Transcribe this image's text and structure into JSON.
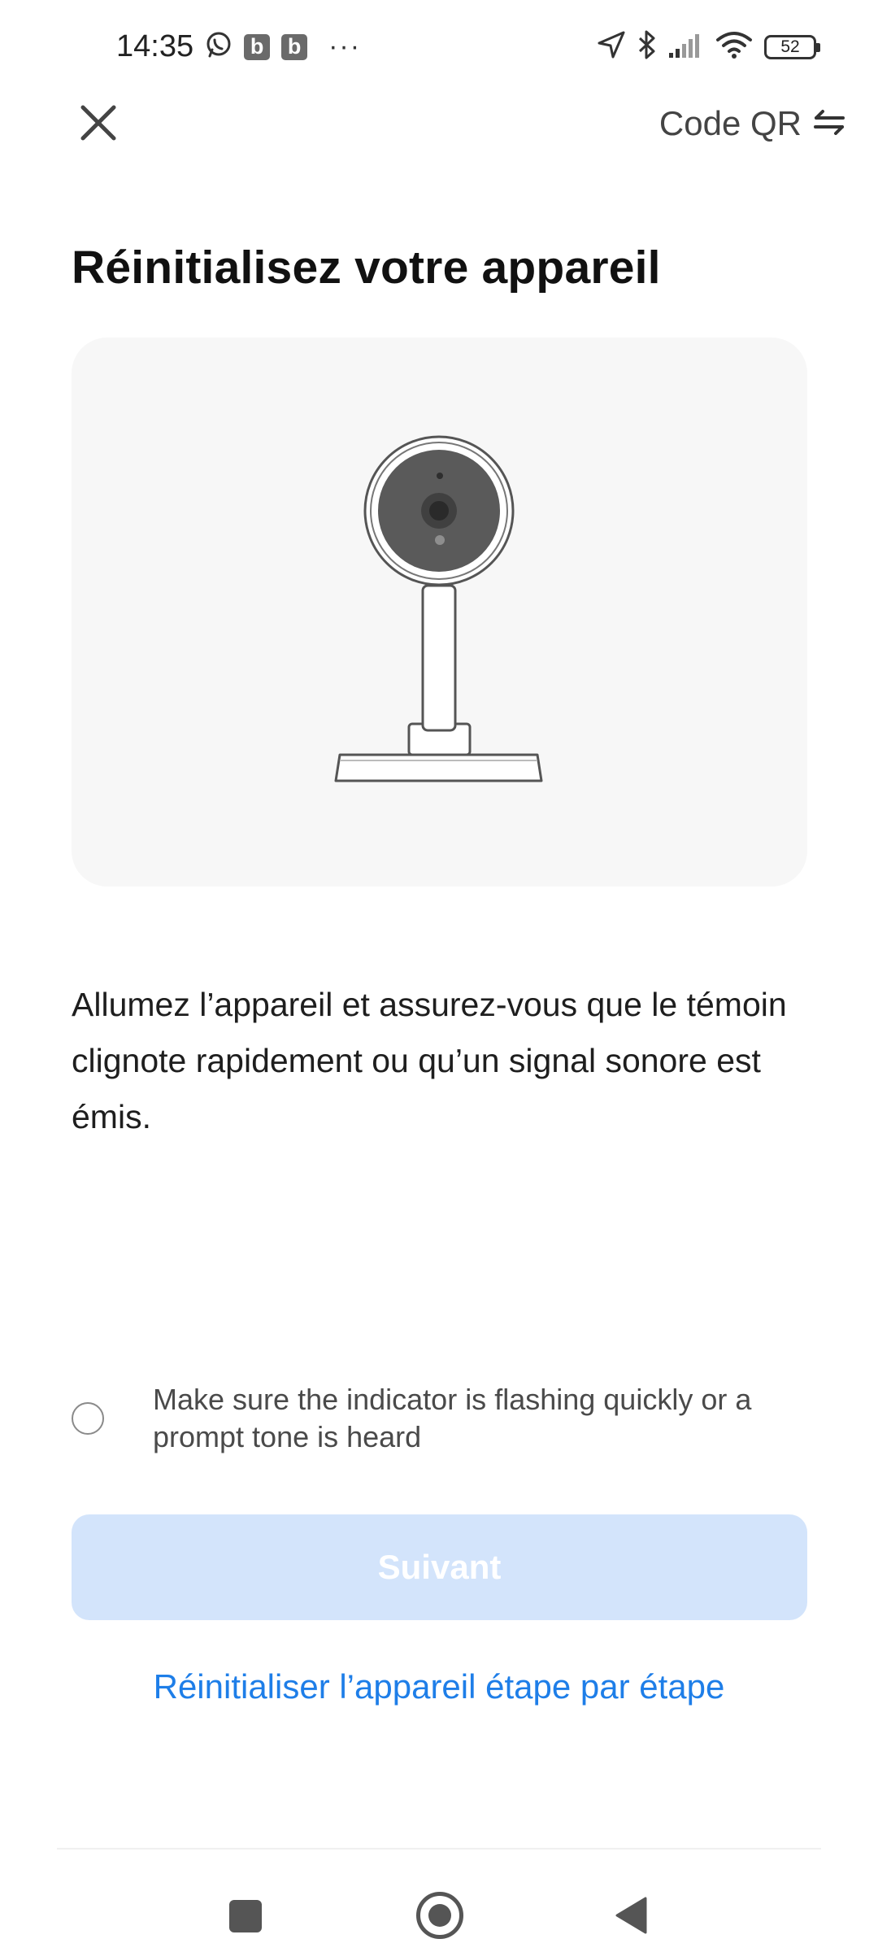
{
  "status_bar": {
    "time": "14:35",
    "badge_1": "b",
    "badge_2": "b",
    "more": "···",
    "battery": "52",
    "icons": [
      "whatsapp-icon",
      "location-icon",
      "bluetooth-icon",
      "signal-icon",
      "wifi-icon",
      "battery-icon"
    ]
  },
  "header": {
    "close_icon": "close-icon",
    "qr_label": "Code QR",
    "qr_icon": "swap-arrows-icon"
  },
  "title": "Réinitialisez votre appareil",
  "illustration": "security-camera",
  "instruction": "Allumez l’appareil et assurez-vous que le témoin clignote rapidement ou qu’un signal sonore est émis.",
  "confirm": {
    "text": "Make sure the indicator is flashing quickly or a prompt tone is heard",
    "checked": false
  },
  "next_button": "Suivant",
  "step_link": "Réinitialiser l’appareil étape par étape",
  "colors": {
    "accent": "#1e7ee8",
    "button_disabled_bg": "#d3e4fb",
    "card_bg": "#f7f7f7"
  },
  "nav_bar": [
    "recent-apps-icon",
    "home-icon",
    "back-icon"
  ]
}
